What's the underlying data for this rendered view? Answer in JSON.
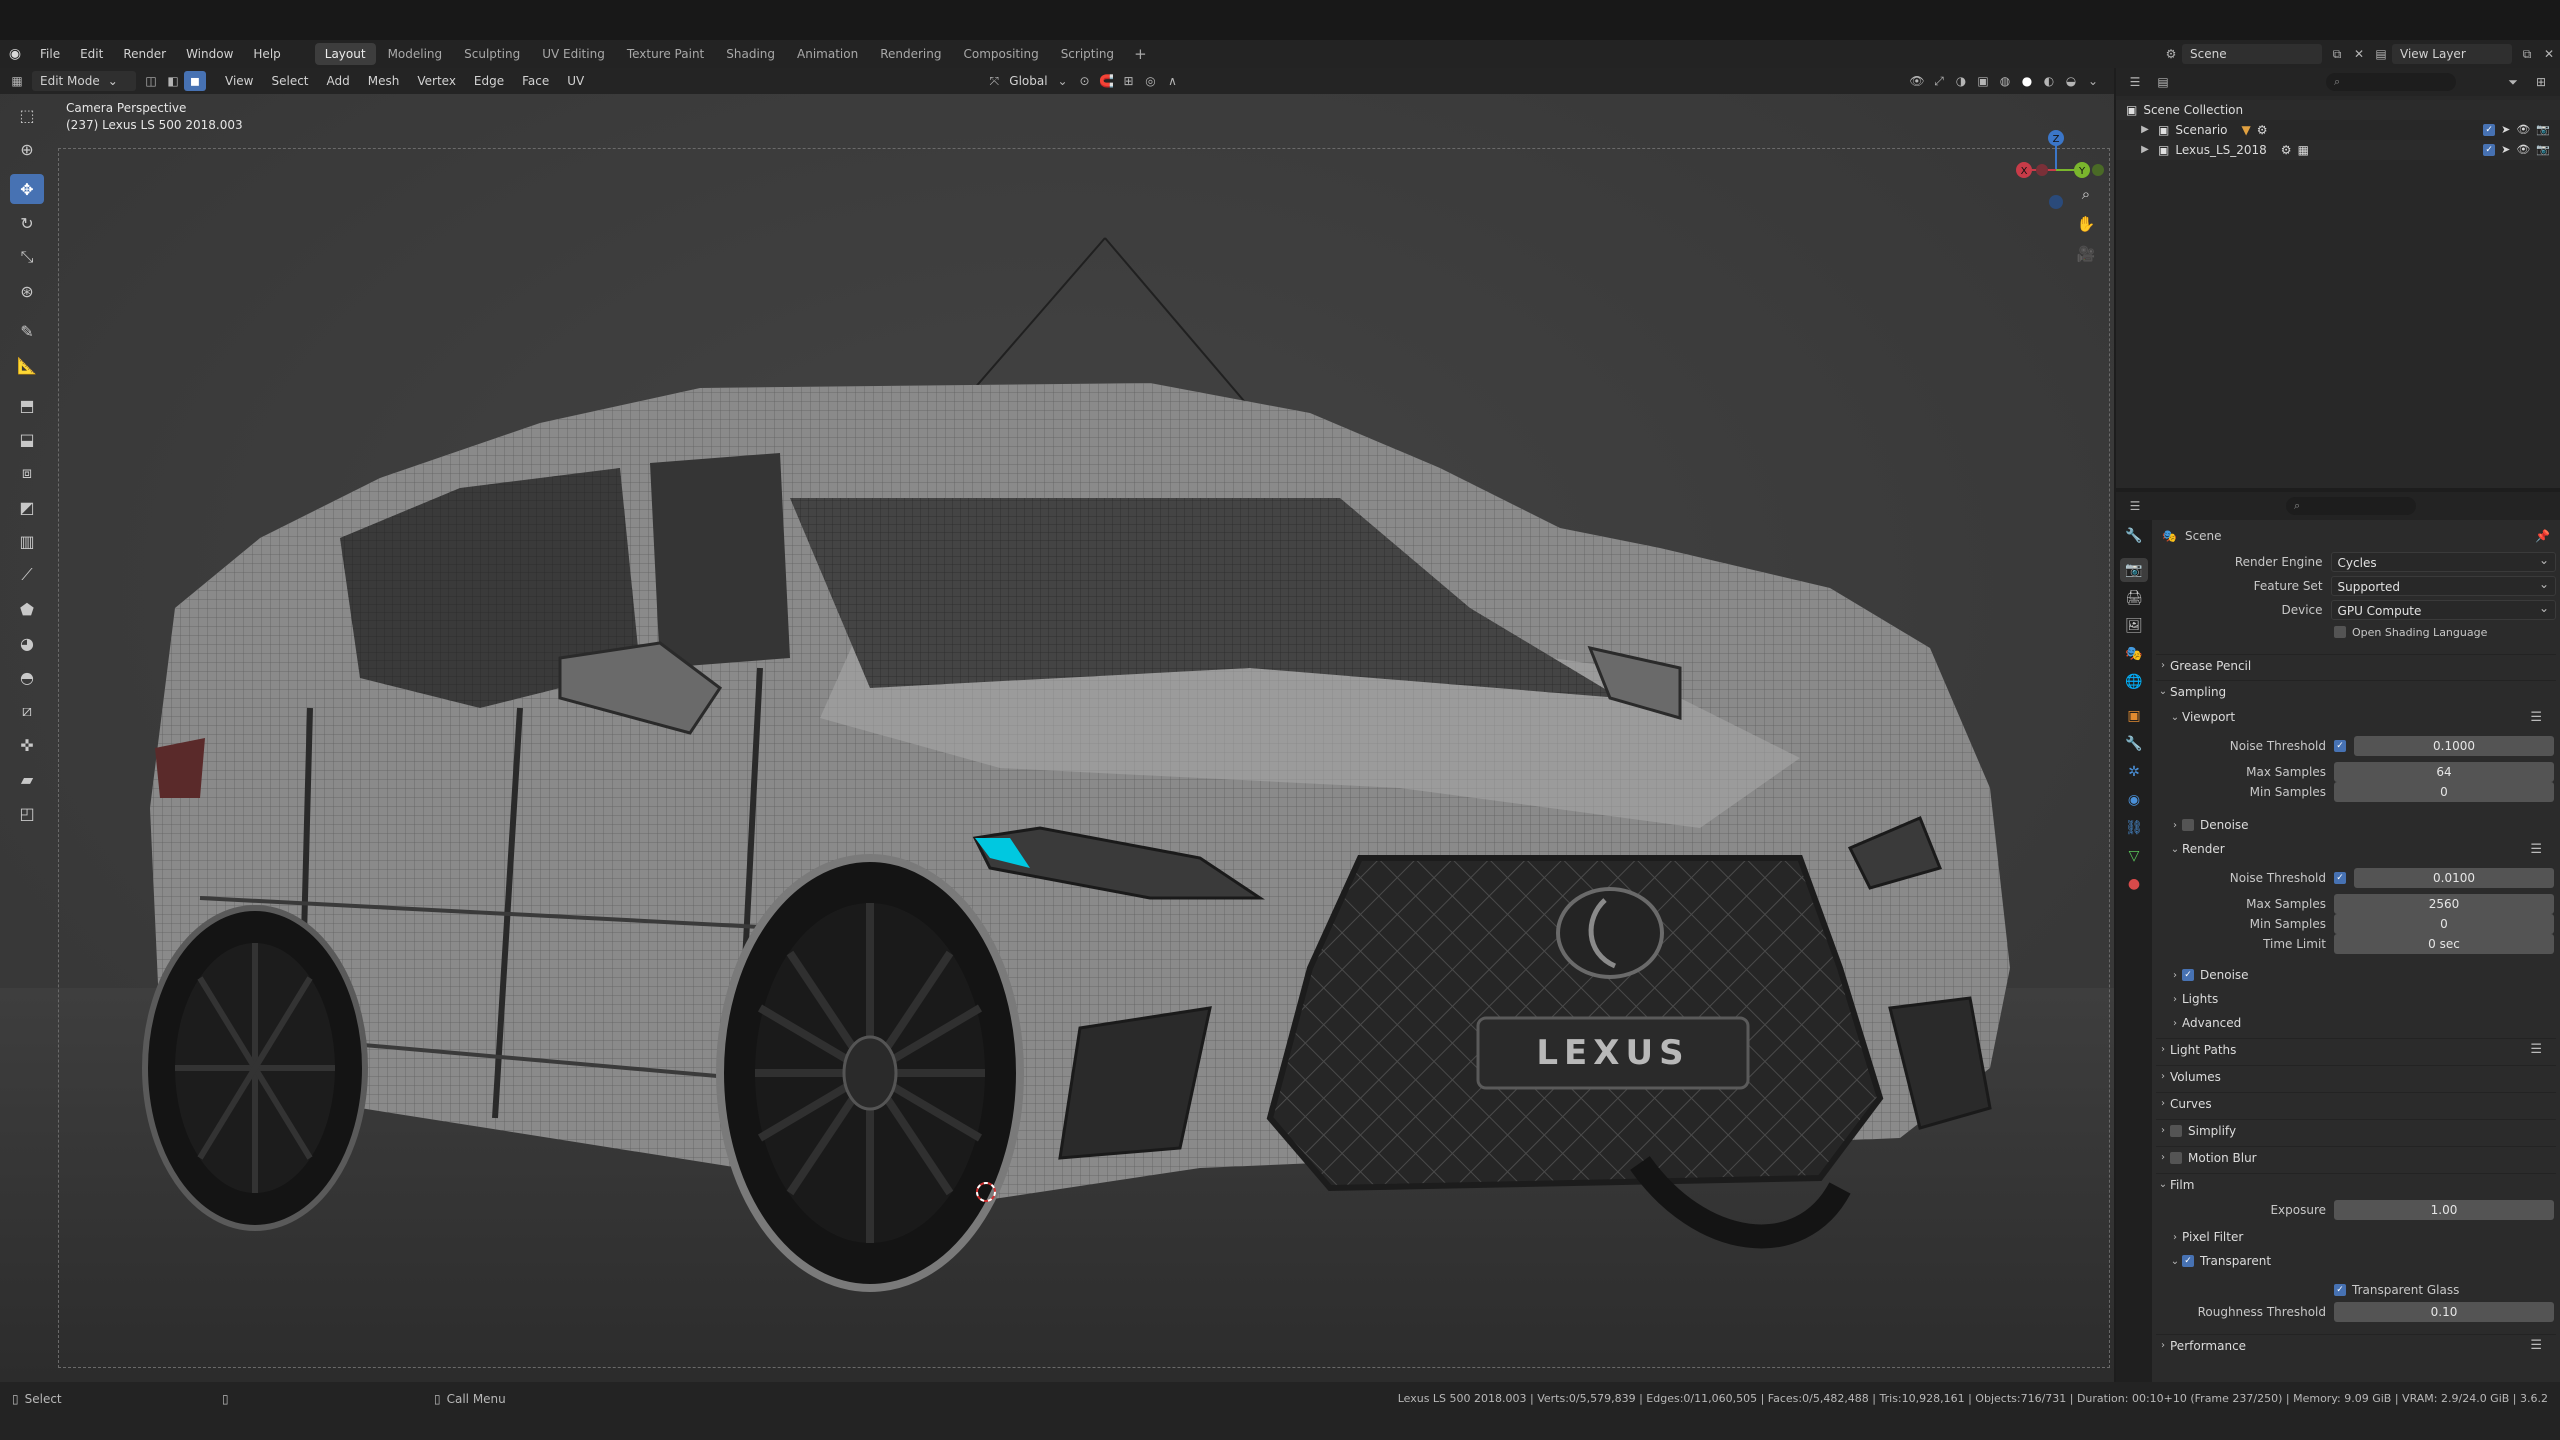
{
  "topbar": {
    "menus": [
      "File",
      "Edit",
      "Render",
      "Window",
      "Help"
    ],
    "workspaces": [
      "Layout",
      "Modeling",
      "Sculpting",
      "UV Editing",
      "Texture Paint",
      "Shading",
      "Animation",
      "Rendering",
      "Compositing",
      "Scripting"
    ],
    "active_workspace": "Layout",
    "scene_name": "Scene",
    "view_layer": "View Layer"
  },
  "viewport": {
    "mode": "Edit Mode",
    "menus": [
      "View",
      "Select",
      "Add",
      "Mesh",
      "Vertex",
      "Edge",
      "Face",
      "UV"
    ],
    "orientation": "Global",
    "camera_label": "Camera Perspective",
    "object_label": "(237) Lexus LS 500 2018.003",
    "grille_text": "LEXUS",
    "gizmo": {
      "x": "X",
      "y": "Y",
      "z": "Z"
    }
  },
  "outliner": {
    "items": [
      {
        "label": "Scene Collection"
      },
      {
        "label": "Scenario"
      },
      {
        "label": "Lexus_LS_2018"
      }
    ]
  },
  "properties": {
    "header_title": "Scene",
    "render_engine_label": "Render Engine",
    "render_engine": "Cycles",
    "feature_set_label": "Feature Set",
    "feature_set": "Supported",
    "device_label": "Device",
    "device": "GPU Compute",
    "osl_label": "Open Shading Language",
    "sections": {
      "grease_pencil": "Grease Pencil",
      "sampling": "Sampling",
      "viewport": "Viewport",
      "denoise_vp": "Denoise",
      "render": "Render",
      "denoise_r": "Denoise",
      "lights": "Lights",
      "advanced": "Advanced",
      "light_paths": "Light Paths",
      "volumes": "Volumes",
      "curves": "Curves",
      "simplify": "Simplify",
      "motion_blur": "Motion Blur",
      "film": "Film",
      "pixel_filter": "Pixel Filter",
      "transparent": "Transparent",
      "performance": "Performance"
    },
    "vp_noise_threshold_label": "Noise Threshold",
    "vp_noise_threshold": "0.1000",
    "vp_max_samples_label": "Max Samples",
    "vp_max_samples": "64",
    "vp_min_samples_label": "Min Samples",
    "vp_min_samples": "0",
    "r_noise_threshold_label": "Noise Threshold",
    "r_noise_threshold": "0.0100",
    "r_max_samples_label": "Max Samples",
    "r_max_samples": "2560",
    "r_min_samples_label": "Min Samples",
    "r_min_samples": "0",
    "time_limit_label": "Time Limit",
    "time_limit": "0 sec",
    "exposure_label": "Exposure",
    "exposure": "1.00",
    "transparent_glass_label": "Transparent Glass",
    "roughness_threshold_label": "Roughness Threshold",
    "roughness_threshold": "0.10"
  },
  "statusbar": {
    "left_select": "Select",
    "call_menu": "Call Menu",
    "stats": "Lexus LS 500 2018.003 | Verts:0/5,579,839 | Edges:0/11,060,505 | Faces:0/5,482,488 | Tris:10,928,161 | Objects:716/731 | Duration: 00:10+10 (Frame 237/250) | Memory: 9.09 GiB | VRAM: 2.9/24.0 GiB | 3.6.2"
  }
}
